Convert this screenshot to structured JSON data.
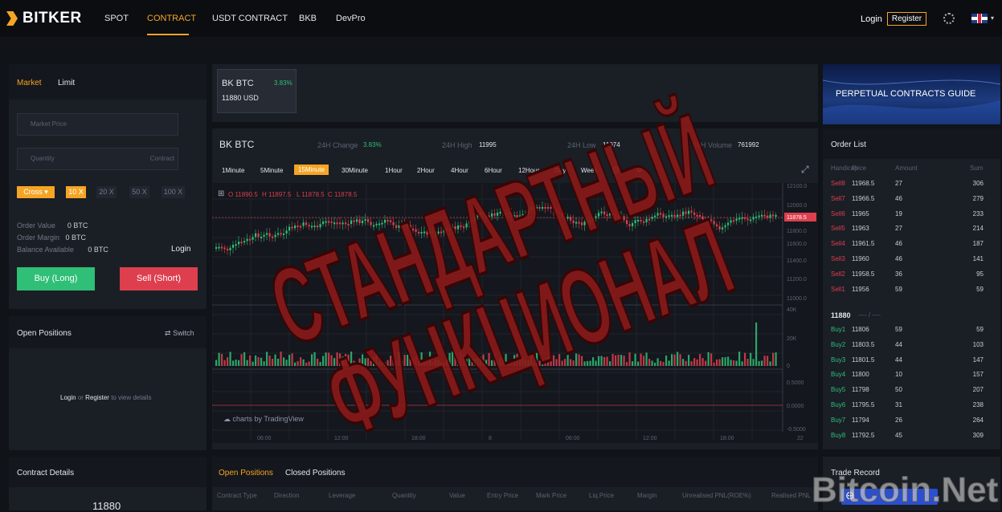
{
  "brand": {
    "name": "BITKER"
  },
  "nav": [
    "SPOT",
    "CONTRACT",
    "USDT CONTRACT",
    "BKB",
    "DevPro"
  ],
  "header": {
    "login": "Login",
    "register": "Register"
  },
  "order_form": {
    "tabs": [
      "Market",
      "Limit"
    ],
    "price_placeholder": "Market Price",
    "quantity_placeholder": "Quantity",
    "quantity_unit": "Contract",
    "margin_mode": "Cross",
    "leverages": [
      "10 X",
      "20 X",
      "50 X",
      "100 X"
    ],
    "order_value_label": "Order Value",
    "order_value": "0 BTC",
    "order_margin_label": "Order Margin",
    "order_margin": "0 BTC",
    "balance_label": "Balance Available",
    "balance": "0 BTC",
    "login": "Login",
    "buy": "Buy (Long)",
    "sell": "Sell (Short)"
  },
  "positions_panel": {
    "title": "Open Positions",
    "switch": "Switch",
    "login": "Login",
    "or": "or",
    "register": "Register",
    "suffix": "to view details"
  },
  "contract_details": {
    "title": "Contract Details",
    "value": "11880"
  },
  "ticker": {
    "symbol": "BK BTC",
    "change": "3.83%",
    "price": "11880 USD"
  },
  "stats": {
    "symbol": "BK BTC",
    "change_label": "24H Change",
    "change": "3.83%",
    "high_label": "24H High",
    "high": "11995",
    "low_label": "24H Low",
    "low": "11074",
    "volume_label": "24H Volume",
    "volume": "761992"
  },
  "intervals": [
    "1Minute",
    "5Minute",
    "15Minute",
    "30Minute",
    "1Hour",
    "2Hour",
    "4Hour",
    "6Hour",
    "12Hour",
    "Day",
    "Week"
  ],
  "ohlc": {
    "o": "O 11890.5",
    "h": "H 11897.5",
    "l": "L 11878.5",
    "c": "C 11878.5"
  },
  "chart_price_ticks": [
    "12100.0",
    "12000.0",
    "11878.5",
    "11800.0",
    "11600.0",
    "11400.0",
    "11200.0",
    "11000.0"
  ],
  "chart_vol_ticks": [
    "40K",
    "20K",
    "0"
  ],
  "chart_ind_ticks": [
    "0.5000",
    "0.0000",
    "-0.5000"
  ],
  "chart_time_ticks": [
    "06:00",
    "12:00",
    "18:00",
    "8",
    "06:00",
    "12:00",
    "18:00",
    "22"
  ],
  "chart_credit": "charts by TradingView",
  "bottom_tabs": [
    "Open Positions",
    "Closed Positions"
  ],
  "table_columns": [
    "Contract Type",
    "Direction",
    "Leverage",
    "Quantity",
    "Value",
    "Entry Price",
    "Mark Price",
    "Liq.Price",
    "Margin",
    "Unrealised PNL(ROE%)",
    "Realised PNL"
  ],
  "guide": {
    "text": "PERPETUAL CONTRACTS GUIDE"
  },
  "order_list": {
    "title": "Order List",
    "headers": [
      "Handicap",
      "Price",
      "Amount",
      "Sum"
    ],
    "sells": [
      {
        "name": "Sell8",
        "price": "11968.5",
        "amount": "27",
        "sum": "306"
      },
      {
        "name": "Sell7",
        "price": "11966.5",
        "amount": "46",
        "sum": "279"
      },
      {
        "name": "Sell6",
        "price": "11965",
        "amount": "19",
        "sum": "233"
      },
      {
        "name": "Sell5",
        "price": "11963",
        "amount": "27",
        "sum": "214"
      },
      {
        "name": "Sell4",
        "price": "11961.5",
        "amount": "46",
        "sum": "187"
      },
      {
        "name": "Sell3",
        "price": "11960",
        "amount": "46",
        "sum": "141"
      },
      {
        "name": "Sell2",
        "price": "11958.5",
        "amount": "36",
        "sum": "95"
      },
      {
        "name": "Sell1",
        "price": "11956",
        "amount": "59",
        "sum": "59"
      }
    ],
    "last": "11880",
    "last_suffix": "---- / ----",
    "buys": [
      {
        "name": "Buy1",
        "price": "11806",
        "amount": "59",
        "sum": "59"
      },
      {
        "name": "Buy2",
        "price": "11803.5",
        "amount": "44",
        "sum": "103"
      },
      {
        "name": "Buy3",
        "price": "11801.5",
        "amount": "44",
        "sum": "147"
      },
      {
        "name": "Buy4",
        "price": "11800",
        "amount": "10",
        "sum": "157"
      },
      {
        "name": "Buy5",
        "price": "11798",
        "amount": "50",
        "sum": "207"
      },
      {
        "name": "Buy6",
        "price": "11795.5",
        "amount": "31",
        "sum": "238"
      },
      {
        "name": "Buy7",
        "price": "11794",
        "amount": "26",
        "sum": "264"
      },
      {
        "name": "Buy8",
        "price": "11792.5",
        "amount": "45",
        "sum": "309"
      }
    ]
  },
  "trade_record": {
    "title": "Trade Record"
  },
  "stamp": {
    "line1": "СТАНДАРТНЫЙ",
    "line2": "ФУНКЦИОНАЛ"
  },
  "watermark": "Bitcoin.Net",
  "colors": {
    "accent": "#f5a524",
    "buy": "#2fbf77",
    "sell": "#dd3f4e",
    "stamp": "#8b1a1a"
  }
}
